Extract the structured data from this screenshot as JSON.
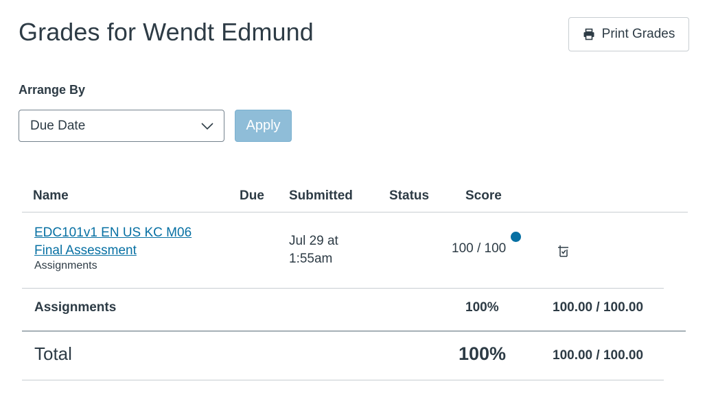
{
  "page": {
    "title": "Grades for Wendt Edmund",
    "print_button_label": "Print Grades"
  },
  "arrange": {
    "label": "Arrange By",
    "selected": "Due Date",
    "apply_label": "Apply"
  },
  "table": {
    "headers": {
      "name": "Name",
      "due": "Due",
      "submitted": "Submitted",
      "status": "Status",
      "score": "Score"
    },
    "rows": [
      {
        "name_line1": "EDC101v1 EN US KC M06",
        "name_line2": "Final Assessment",
        "group": "Assignments",
        "due": "",
        "submitted_line1": "Jul 29 at",
        "submitted_line2": "1:55am",
        "status": "",
        "score": "100 / 100",
        "unread": true,
        "icon": "what-if-grade-icon"
      }
    ],
    "group_summary": {
      "label": "Assignments",
      "percent": "100%",
      "points": "100.00 / 100.00"
    },
    "total": {
      "label": "Total",
      "percent": "100%",
      "points": "100.00 / 100.00"
    }
  },
  "colors": {
    "link": "#0770a3",
    "text": "#2d3b45",
    "apply_bg": "#8fbdd8",
    "unread_dot": "#0770a3"
  }
}
